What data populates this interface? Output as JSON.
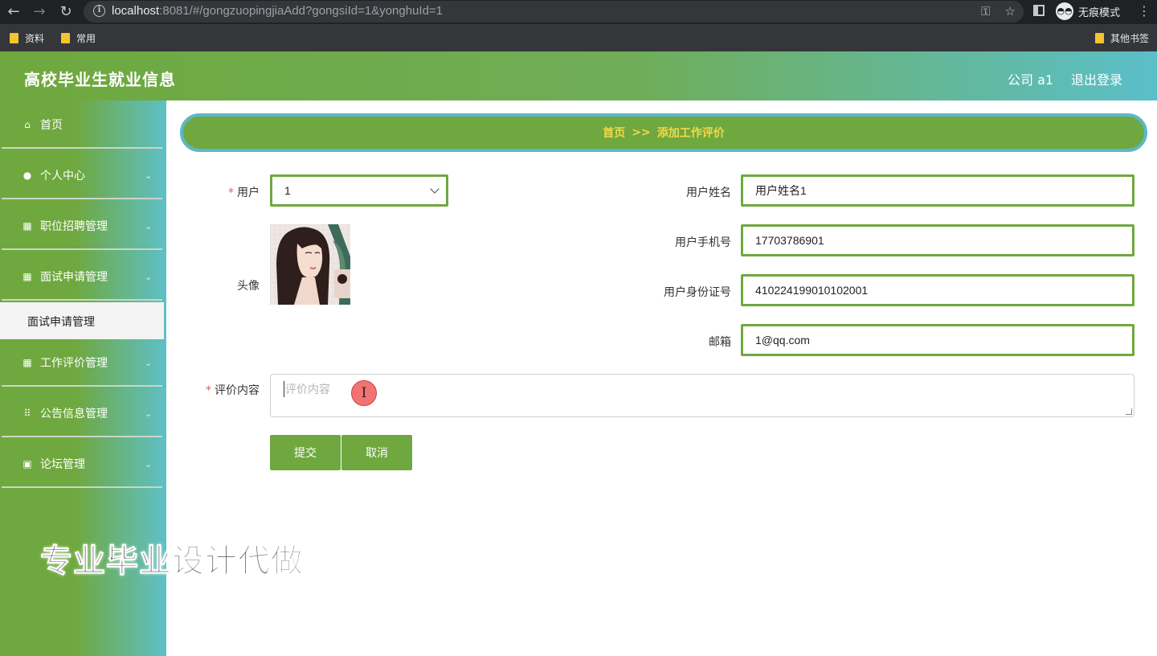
{
  "browser": {
    "url_host": "localhost",
    "url_rest": ":8081/#/gongzuopingjiaAdd?gongsiId=1&yonghuId=1",
    "incognito_label": "无痕模式",
    "bookmarks": [
      "资料",
      "常用"
    ],
    "other_bookmarks": "其他书签"
  },
  "header": {
    "title": "高校毕业生就业信息",
    "user": "公司 a1",
    "logout": "退出登录"
  },
  "sidebar": {
    "items": [
      {
        "label": "首页",
        "icon": "home-icon"
      },
      {
        "label": "个人中心",
        "icon": "user-icon"
      },
      {
        "label": "职位招聘管理",
        "icon": "grid-icon"
      },
      {
        "label": "面试申请管理",
        "icon": "grid-icon"
      },
      {
        "label": "工作评价管理",
        "icon": "grid-icon"
      },
      {
        "label": "公告信息管理",
        "icon": "apps-icon"
      },
      {
        "label": "论坛管理",
        "icon": "clipboard-icon"
      }
    ],
    "sub_item": "面试申请管理"
  },
  "watermark": "专业毕业设计代做",
  "breadcrumb": {
    "home": "首页",
    "sep": ">>",
    "current": "添加工作评价"
  },
  "form": {
    "user_label": "用户",
    "user_value": "1",
    "avatar_label": "头像",
    "name_label": "用户姓名",
    "name_value": "用户姓名1",
    "phone_label": "用户手机号",
    "phone_value": "17703786901",
    "id_label": "用户身份证号",
    "id_value": "410224199010102001",
    "email_label": "邮箱",
    "email_value": "1@qq.com",
    "content_label": "评价内容",
    "content_placeholder": "评价内容",
    "submit": "提交",
    "cancel": "取消"
  },
  "colors": {
    "primary": "#6fa83e",
    "accent": "#5cb8c8",
    "breadcrumb_text": "#f3d94a"
  }
}
